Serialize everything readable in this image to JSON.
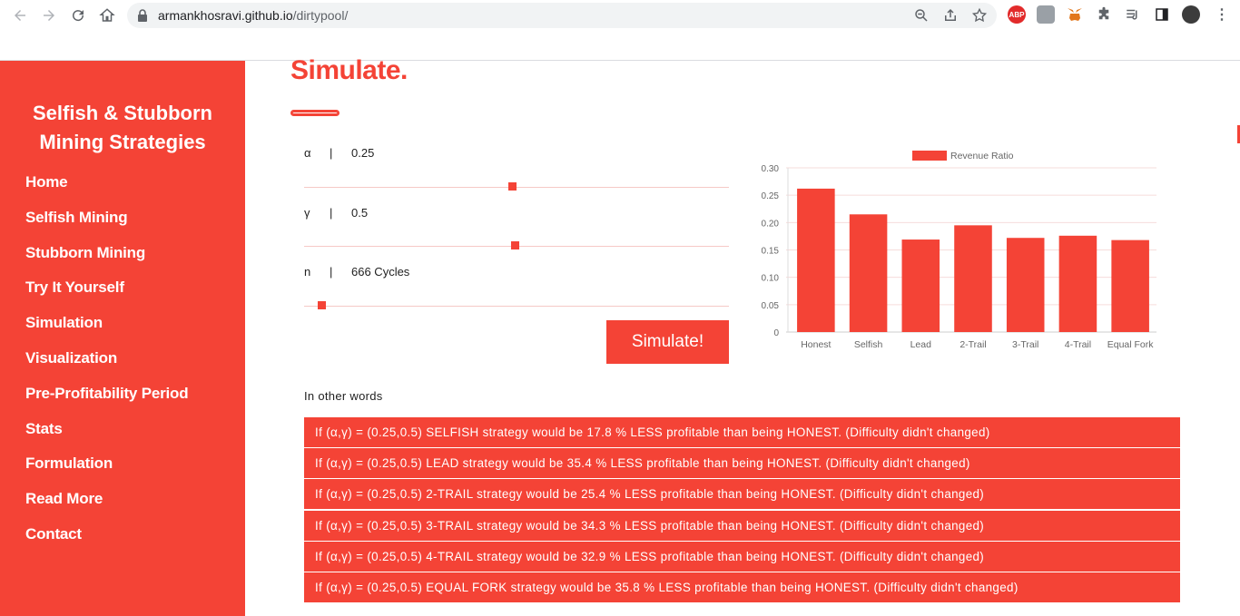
{
  "browser": {
    "url_host": "armankhosravi.github.io",
    "url_path": "/dirtypool/",
    "icons": [
      "back-icon",
      "forward-icon",
      "reload-icon",
      "home-icon",
      "lock-icon",
      "zoom-icon",
      "share-icon",
      "star-icon",
      "abp-extension-icon",
      "extension-icon",
      "metamask-icon",
      "puzzle-icon",
      "media-icon",
      "sidepanel-icon",
      "profile-avatar",
      "menu-icon"
    ],
    "abp_label": "ABP"
  },
  "sidebar": {
    "title_line1": "Selfish & Stubborn",
    "title_line2": "Mining Strategies",
    "items": [
      {
        "label": "Home"
      },
      {
        "label": "Selfish Mining"
      },
      {
        "label": "Stubborn Mining"
      },
      {
        "label": "Try It Yourself"
      },
      {
        "label": "Simulation"
      },
      {
        "label": "Visualization"
      },
      {
        "label": "Pre-Profitability Period"
      },
      {
        "label": "Stats"
      },
      {
        "label": "Formulation"
      },
      {
        "label": "Read More"
      },
      {
        "label": "Contact"
      }
    ]
  },
  "main": {
    "title": "Simulate.",
    "params": [
      {
        "symbol": "α",
        "sep": "|",
        "value": "0.25",
        "fraction": 0.49
      },
      {
        "symbol": "γ",
        "sep": "|",
        "value": "0.5",
        "fraction": 0.495
      },
      {
        "symbol": "n",
        "sep": "|",
        "value": "666 Cycles",
        "fraction": 0.04
      }
    ],
    "simulate_label": "Simulate!",
    "other_words": "In other words",
    "results": [
      "If (α,γ) = (0.25,0.5) SELFISH strategy would be 17.8 % LESS profitable than being HONEST. (Difficulty didn't changed)",
      "If (α,γ) = (0.25,0.5) LEAD strategy would be 35.4 % LESS profitable than being HONEST. (Difficulty didn't changed)",
      "If (α,γ) = (0.25,0.5) 2-TRAIL strategy would be 25.4 % LESS profitable than being HONEST. (Difficulty didn't changed)",
      "If (α,γ) = (0.25,0.5) 3-TRAIL strategy would be 34.3 % LESS profitable than being HONEST. (Difficulty didn't changed)",
      "If (α,γ) = (0.25,0.5) 4-TRAIL strategy would be 32.9 % LESS profitable than being HONEST. (Difficulty didn't changed)",
      "If (α,γ) = (0.25,0.5) EQUAL FORK strategy would be 35.8 % LESS profitable than being HONEST. (Difficulty didn't changed)"
    ]
  },
  "colors": {
    "accent": "#f44336",
    "grid": "#f6dcdb",
    "axis_text": "#666666"
  },
  "chart_data": {
    "type": "bar",
    "categories": [
      "Honest",
      "Selfish",
      "Lead",
      "2-Trail",
      "3-Trail",
      "4-Trail",
      "Equal Fork"
    ],
    "series": [
      {
        "name": "Revenue Ratio",
        "values": [
          0.262,
          0.215,
          0.169,
          0.195,
          0.172,
          0.176,
          0.168
        ]
      }
    ],
    "yticks": [
      "0",
      "0.05",
      "0.10",
      "0.15",
      "0.20",
      "0.25",
      "0.30"
    ],
    "ylim": [
      0,
      0.3
    ],
    "legend": "top-center",
    "grid": true
  }
}
